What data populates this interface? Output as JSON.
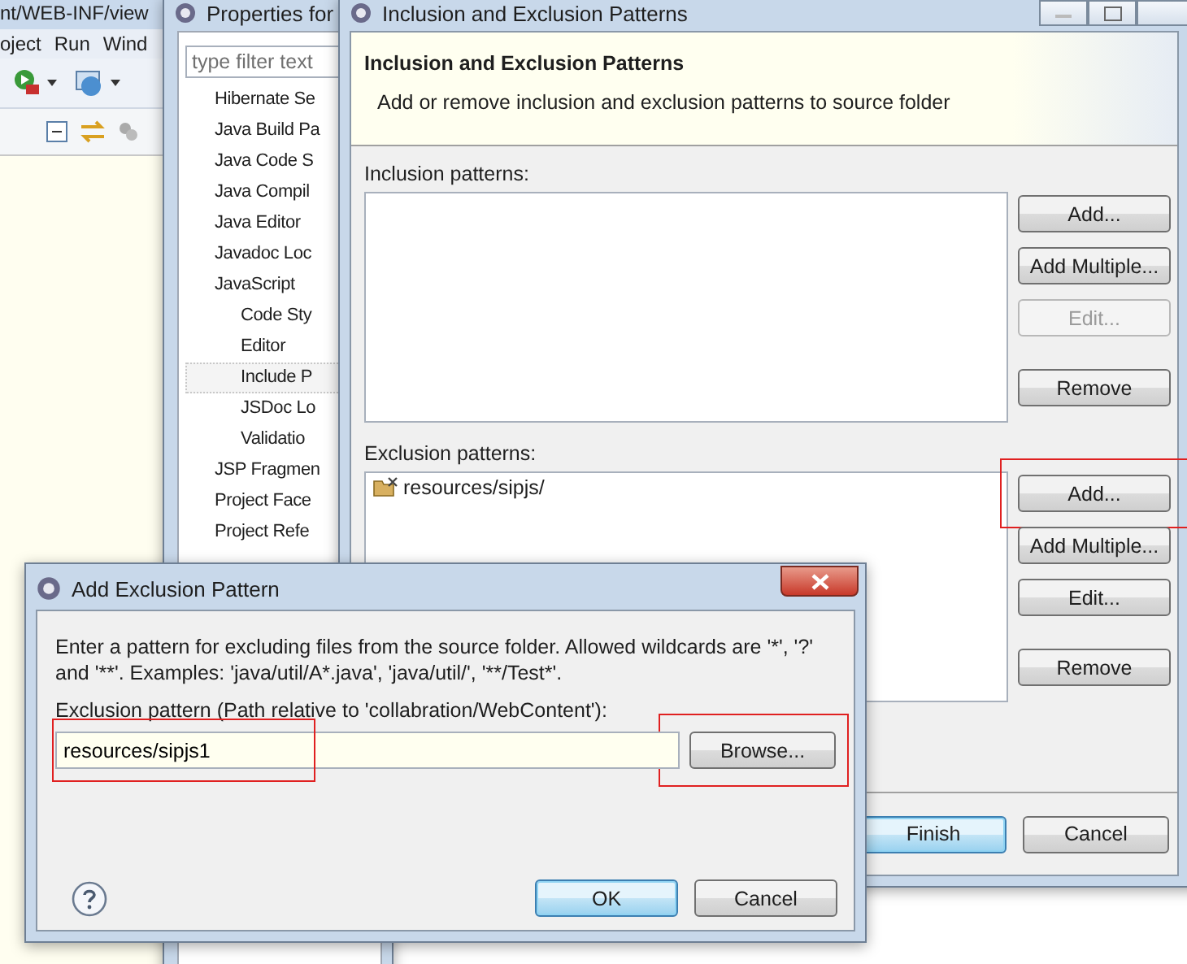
{
  "ide": {
    "title": "nt/WEB-INF/view",
    "menu": [
      "oject",
      "Run",
      "Wind"
    ]
  },
  "properties": {
    "title": "Properties for",
    "filter": {
      "placeholder": "type filter text"
    },
    "tree": [
      {
        "label": "Hibernate Se",
        "selected": false
      },
      {
        "label": "Java Build Pa",
        "selected": false
      },
      {
        "label": "Java Code S",
        "selected": false
      },
      {
        "label": "Java Compil",
        "selected": false
      },
      {
        "label": "Java Editor",
        "selected": false
      },
      {
        "label": "Javadoc Loc",
        "selected": false
      },
      {
        "label": "JavaScript",
        "selected": false,
        "children": [
          {
            "label": "Code Sty",
            "selected": false
          },
          {
            "label": "Editor",
            "selected": false
          },
          {
            "label": "Include P",
            "selected": true
          },
          {
            "label": "JSDoc Lo",
            "selected": false
          },
          {
            "label": "Validatio",
            "selected": false
          }
        ]
      },
      {
        "label": "JSP Fragmen",
        "selected": false
      },
      {
        "label": "Project Face",
        "selected": false
      },
      {
        "label": "Project Refe",
        "selected": false
      }
    ]
  },
  "patterns_dialog": {
    "title": "Inclusion and Exclusion Patterns",
    "heading": "Inclusion and Exclusion Patterns",
    "description": "Add or remove inclusion and exclusion patterns to source folder",
    "inclusion": {
      "label": "Inclusion patterns:",
      "buttons": [
        {
          "label": "Add...",
          "disabled": false,
          "highlighted": false
        },
        {
          "label": "Add Multiple...",
          "disabled": false,
          "highlighted": false
        },
        {
          "label": "Edit...",
          "disabled": true,
          "highlighted": false
        },
        {
          "label": "Remove",
          "disabled": false,
          "highlighted": false
        }
      ]
    },
    "exclusion": {
      "label": "Exclusion patterns:",
      "items": [
        "resources/sipjs/"
      ],
      "buttons": [
        {
          "label": "Add...",
          "disabled": false,
          "highlighted": true
        },
        {
          "label": "Add Multiple...",
          "disabled": false,
          "highlighted": false
        },
        {
          "label": "Edit...",
          "disabled": false,
          "highlighted": false
        },
        {
          "label": "Remove",
          "disabled": false,
          "highlighted": false
        }
      ]
    },
    "footer": [
      {
        "label": "Finish",
        "default": true
      },
      {
        "label": "Cancel",
        "default": false
      }
    ]
  },
  "add_dialog": {
    "title": "Add Exclusion Pattern",
    "message": "Enter a pattern for excluding files from the source folder. Allowed wildcards are '*', '?' and '**'. Examples: 'java/util/A*.java', 'java/util/', '**/Test*'.",
    "field_label": "Exclusion pattern (Path relative to 'collabration/WebContent'):",
    "field": {
      "value": "resources/sipjs1",
      "highlighted": true
    },
    "browse": {
      "label": "Browse...",
      "highlighted": true
    },
    "footer": [
      {
        "label": "OK",
        "default": true
      },
      {
        "label": "Cancel",
        "default": false
      }
    ]
  }
}
